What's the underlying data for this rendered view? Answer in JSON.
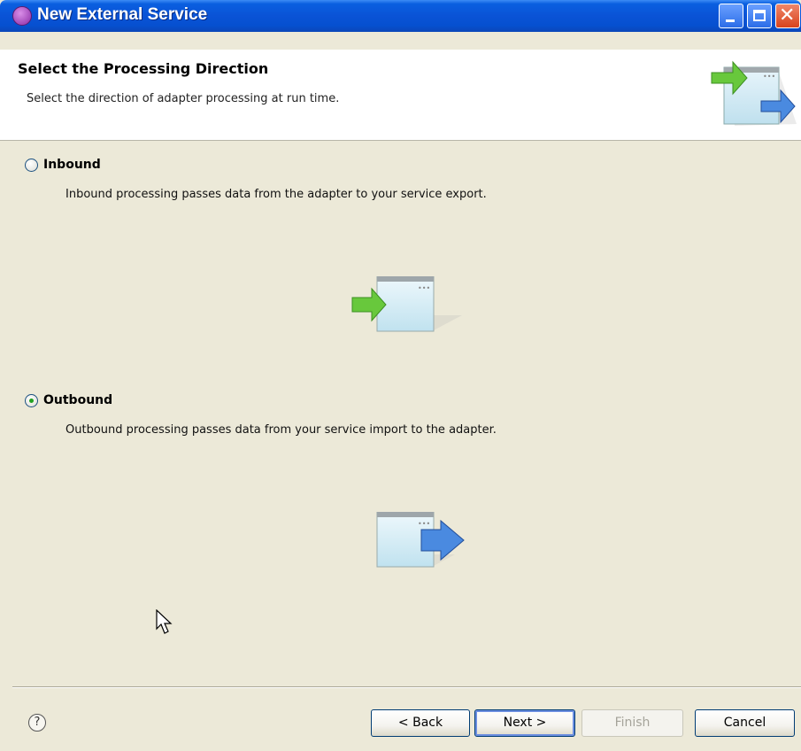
{
  "window": {
    "title": "New External Service",
    "icon": "wizard-app-icon",
    "controls": [
      "minimize-icon",
      "maximize-icon",
      "close-icon"
    ]
  },
  "banner": {
    "title": "Select the Processing Direction",
    "description": "Select the direction of adapter processing at run time.",
    "icon": "processing-direction-icon"
  },
  "options": [
    {
      "label": "Inbound",
      "description": "Inbound processing passes data from the adapter to your service export.",
      "selected": false,
      "icon": "inbound-arrow-icon"
    },
    {
      "label": "Outbound",
      "description": "Outbound processing passes data from your service import to the adapter.",
      "selected": true,
      "icon": "outbound-arrow-icon"
    }
  ],
  "footer": {
    "help_label": "?",
    "back_label": "< Back",
    "next_label": "Next >",
    "finish_label": "Finish",
    "cancel_label": "Cancel",
    "finish_enabled": false
  },
  "colors": {
    "titlebar": "#0a53d6",
    "dialog_bg": "#ece9d8",
    "inbound_arrow": "#5fc232",
    "outbound_arrow": "#3f7fdc"
  }
}
